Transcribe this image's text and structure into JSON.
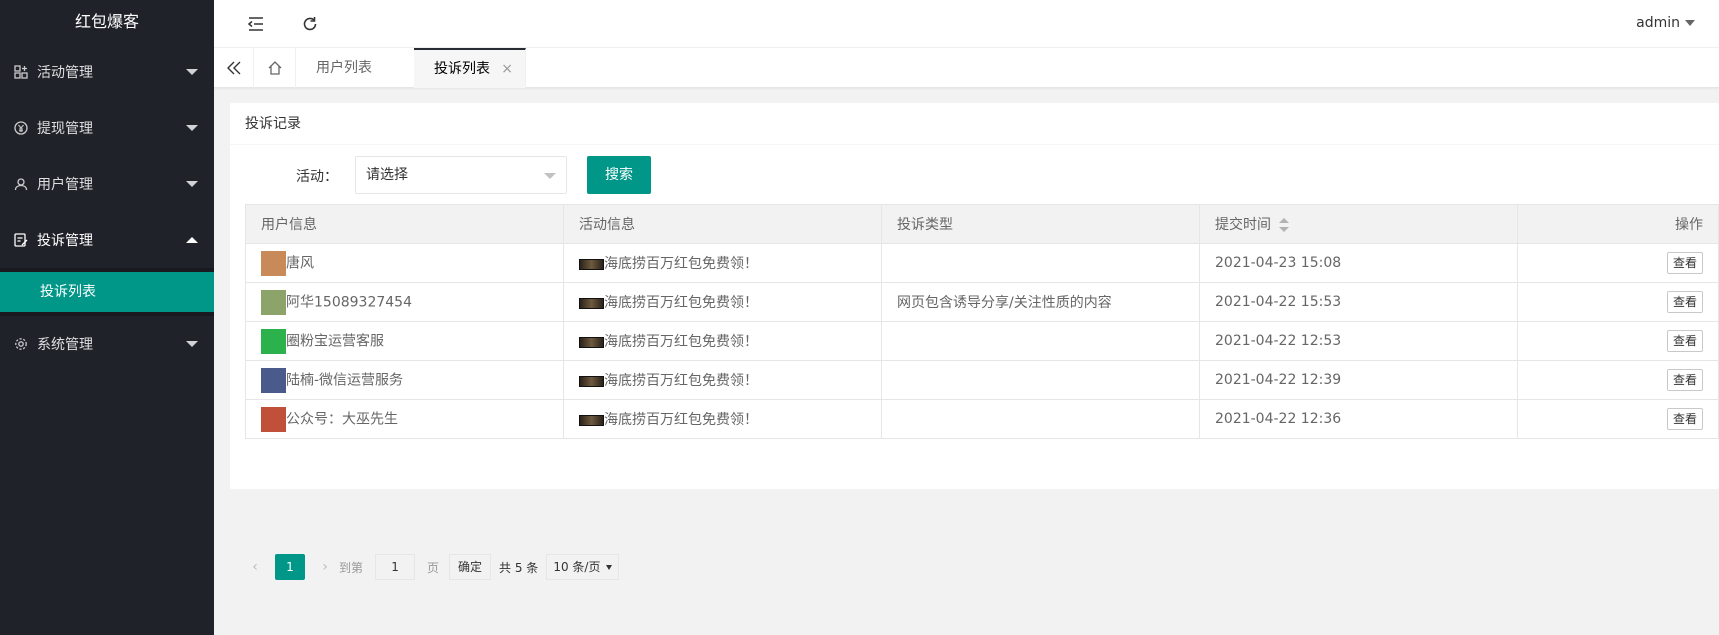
{
  "app": {
    "title": "红包爆客"
  },
  "sidebar": {
    "items": [
      {
        "label": "活动管理",
        "icon": "grid-icon"
      },
      {
        "label": "提现管理",
        "icon": "yen-icon"
      },
      {
        "label": "用户管理",
        "icon": "user-icon"
      },
      {
        "label": "投诉管理",
        "icon": "complaint-icon",
        "open": true
      },
      {
        "label": "系统管理",
        "icon": "gear-icon"
      }
    ],
    "subitems": [
      {
        "label": "投诉列表"
      }
    ]
  },
  "header": {
    "user": "admin"
  },
  "tabs": [
    {
      "label": "用户列表",
      "close": "×"
    },
    {
      "label": "投诉列表",
      "close": "×",
      "active": true
    }
  ],
  "card": {
    "title": "投诉记录",
    "filter_label": "活动：",
    "select_value": "请选择",
    "search_label": "搜索"
  },
  "table": {
    "columns": [
      "用户信息",
      "活动信息",
      "投诉类型",
      "提交时间",
      "操作"
    ],
    "rows": [
      {
        "user": "唐风",
        "activity": "海底捞百万红包免费领！",
        "type": "",
        "time": "2021-04-23 15:08",
        "action": "查看"
      },
      {
        "user": "阿华15089327454",
        "activity": "海底捞百万红包免费领！",
        "type": "网页包含诱导分享/关注性质的内容",
        "time": "2021-04-22 15:53",
        "action": "查看"
      },
      {
        "user": "圈粉宝运营客服",
        "activity": "海底捞百万红包免费领！",
        "type": "",
        "time": "2021-04-22 12:53",
        "action": "查看"
      },
      {
        "user": "陆楠-微信运营服务",
        "activity": "海底捞百万红包免费领！",
        "type": "",
        "time": "2021-04-22 12:39",
        "action": "查看"
      },
      {
        "user": "公众号：大巫先生",
        "activity": "海底捞百万红包免费领！",
        "type": "",
        "time": "2021-04-22 12:36",
        "action": "查看"
      }
    ]
  },
  "pager": {
    "prev": "‹",
    "current": "1",
    "next": "›",
    "goto_label": "到第",
    "goto_value": "1",
    "page_unit": "页",
    "confirm": "确定",
    "total": "共 5 条",
    "limit": "10 条/页"
  },
  "colors": {
    "accent": "#009688",
    "sidebar_bg": "#20222a"
  }
}
